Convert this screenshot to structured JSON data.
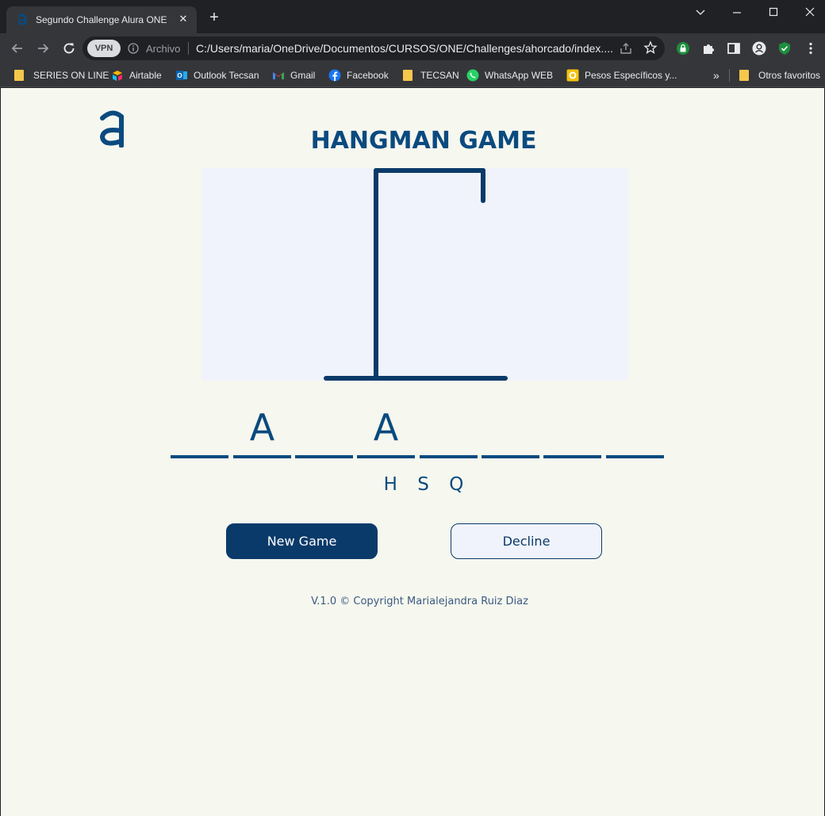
{
  "browser": {
    "tab_title": "Segundo Challenge Alura ONE",
    "tab_close": "✕",
    "new_tab": "+",
    "vpn_badge": "VPN",
    "address_label": "Archivo",
    "url": "C:/Users/maria/OneDrive/Documentos/CURSOS/ONE/Challenges/ahorcado/index....",
    "bookmarks": [
      {
        "label": "SERIES ON LINE",
        "icon": "folder-icon"
      },
      {
        "label": "Airtable",
        "icon": "airtable-icon"
      },
      {
        "label": "Outlook Tecsan",
        "icon": "outlook-icon"
      },
      {
        "label": "Gmail",
        "icon": "gmail-icon"
      },
      {
        "label": "Facebook",
        "icon": "facebook-icon"
      },
      {
        "label": "TECSAN",
        "icon": "folder-icon"
      },
      {
        "label": "WhatsApp WEB",
        "icon": "whatsapp-icon"
      },
      {
        "label": "Pesos Específicos y...",
        "icon": "site-icon"
      }
    ],
    "bookmarks_overflow": "»",
    "other_bookmarks": "Otros favoritos"
  },
  "page": {
    "title": "HANGMAN GAME",
    "word_slots": [
      "",
      "A",
      "",
      "A",
      "",
      "",
      "",
      ""
    ],
    "wrong_letters": [
      "H",
      "S",
      "Q"
    ],
    "new_game_label": "New Game",
    "decline_label": "Decline",
    "footer": "V.1.0 © Copyright Marialejandra Ruiz Diaz"
  },
  "colors": {
    "primary": "#0a3a69",
    "text_blue": "#0a4a7f",
    "background": "#f6f7ef",
    "canvas": "#f0f3fb"
  }
}
